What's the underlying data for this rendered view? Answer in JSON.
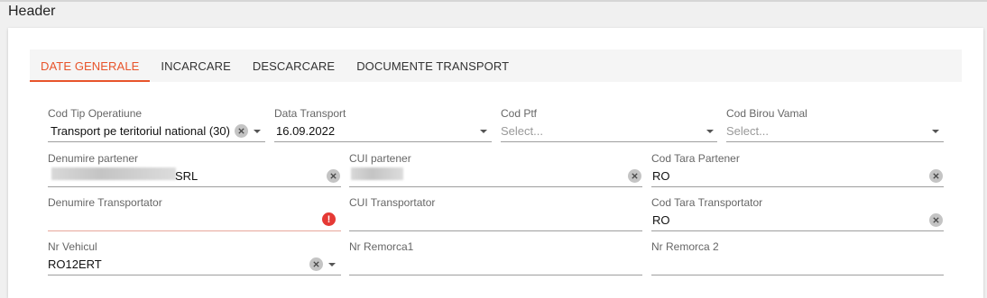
{
  "header": {
    "title": "Header"
  },
  "tabs": [
    {
      "label": "DATE GENERALE",
      "active": true
    },
    {
      "label": "INCARCARE",
      "active": false
    },
    {
      "label": "DESCARCARE",
      "active": false
    },
    {
      "label": "DOCUMENTE TRANSPORT",
      "active": false
    }
  ],
  "fields": {
    "cod_tip_operatiune": {
      "label": "Cod Tip Operatiune",
      "value": "Transport pe teritoriul national (30)"
    },
    "data_transport": {
      "label": "Data Transport",
      "value": "16.09.2022"
    },
    "cod_ptf": {
      "label": "Cod Ptf",
      "placeholder": "Select..."
    },
    "cod_birou_vamal": {
      "label": "Cod Birou Vamal",
      "placeholder": "Select..."
    },
    "denumire_partener": {
      "label": "Denumire partener",
      "value": "SRL"
    },
    "cui_partener": {
      "label": "CUI partener",
      "value": ""
    },
    "cod_tara_partener": {
      "label": "Cod Tara Partener",
      "value": "RO"
    },
    "denumire_transportator": {
      "label": "Denumire Transportator",
      "value": ""
    },
    "cui_transportator": {
      "label": "CUI Transportator",
      "value": ""
    },
    "cod_tara_transportator": {
      "label": "Cod Tara Transportator",
      "value": "RO"
    },
    "nr_vehicul": {
      "label": "Nr Vehicul",
      "value": "RO12ERT"
    },
    "nr_remorca1": {
      "label": "Nr Remorca1",
      "value": ""
    },
    "nr_remorca2": {
      "label": "Nr Remorca 2",
      "value": ""
    }
  },
  "colors": {
    "accent": "#e8542b",
    "error": "#e53935"
  },
  "icons": {
    "clear": "clear-icon",
    "dropdown": "chevron-down-icon",
    "error": "error-icon"
  }
}
